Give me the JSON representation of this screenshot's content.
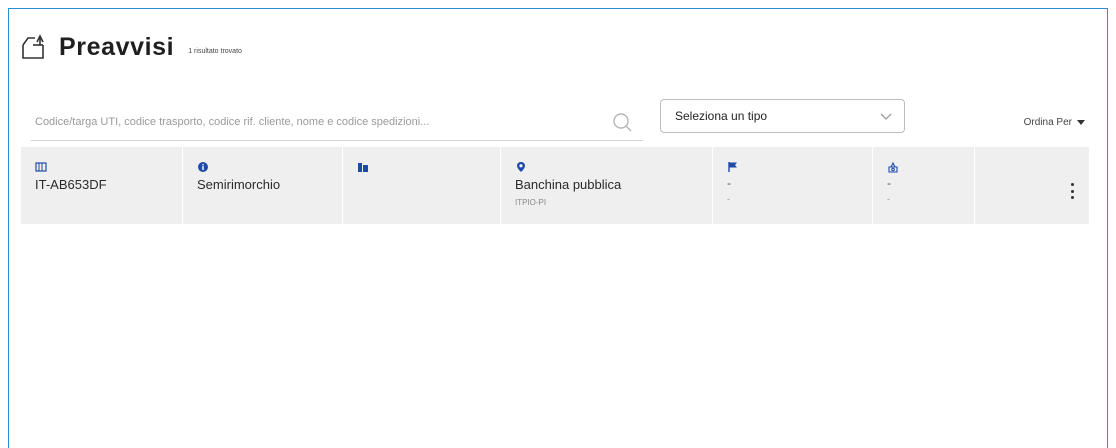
{
  "header": {
    "title": "Preavvisi",
    "count": "1 risultato trovato"
  },
  "search": {
    "placeholder": "Codice/targa UTI, codice trasporto, codice rif. cliente, nome e codice spedizioni..."
  },
  "type_select": {
    "value": "Seleziona un tipo"
  },
  "sort": {
    "label": "Ordina Per"
  },
  "row": {
    "plate": "IT-AB653DF",
    "unit_type": "Semirimorchio",
    "location": "Banchina pubblica",
    "location_code": "ITPIO-PI",
    "flag_value": "-",
    "flag_sub": "-",
    "status_value": "-",
    "status_sub": "-"
  },
  "colors": {
    "accent": "#2a8fd0",
    "icon_blue": "#1f4aa8",
    "row_bg": "#efefef"
  }
}
